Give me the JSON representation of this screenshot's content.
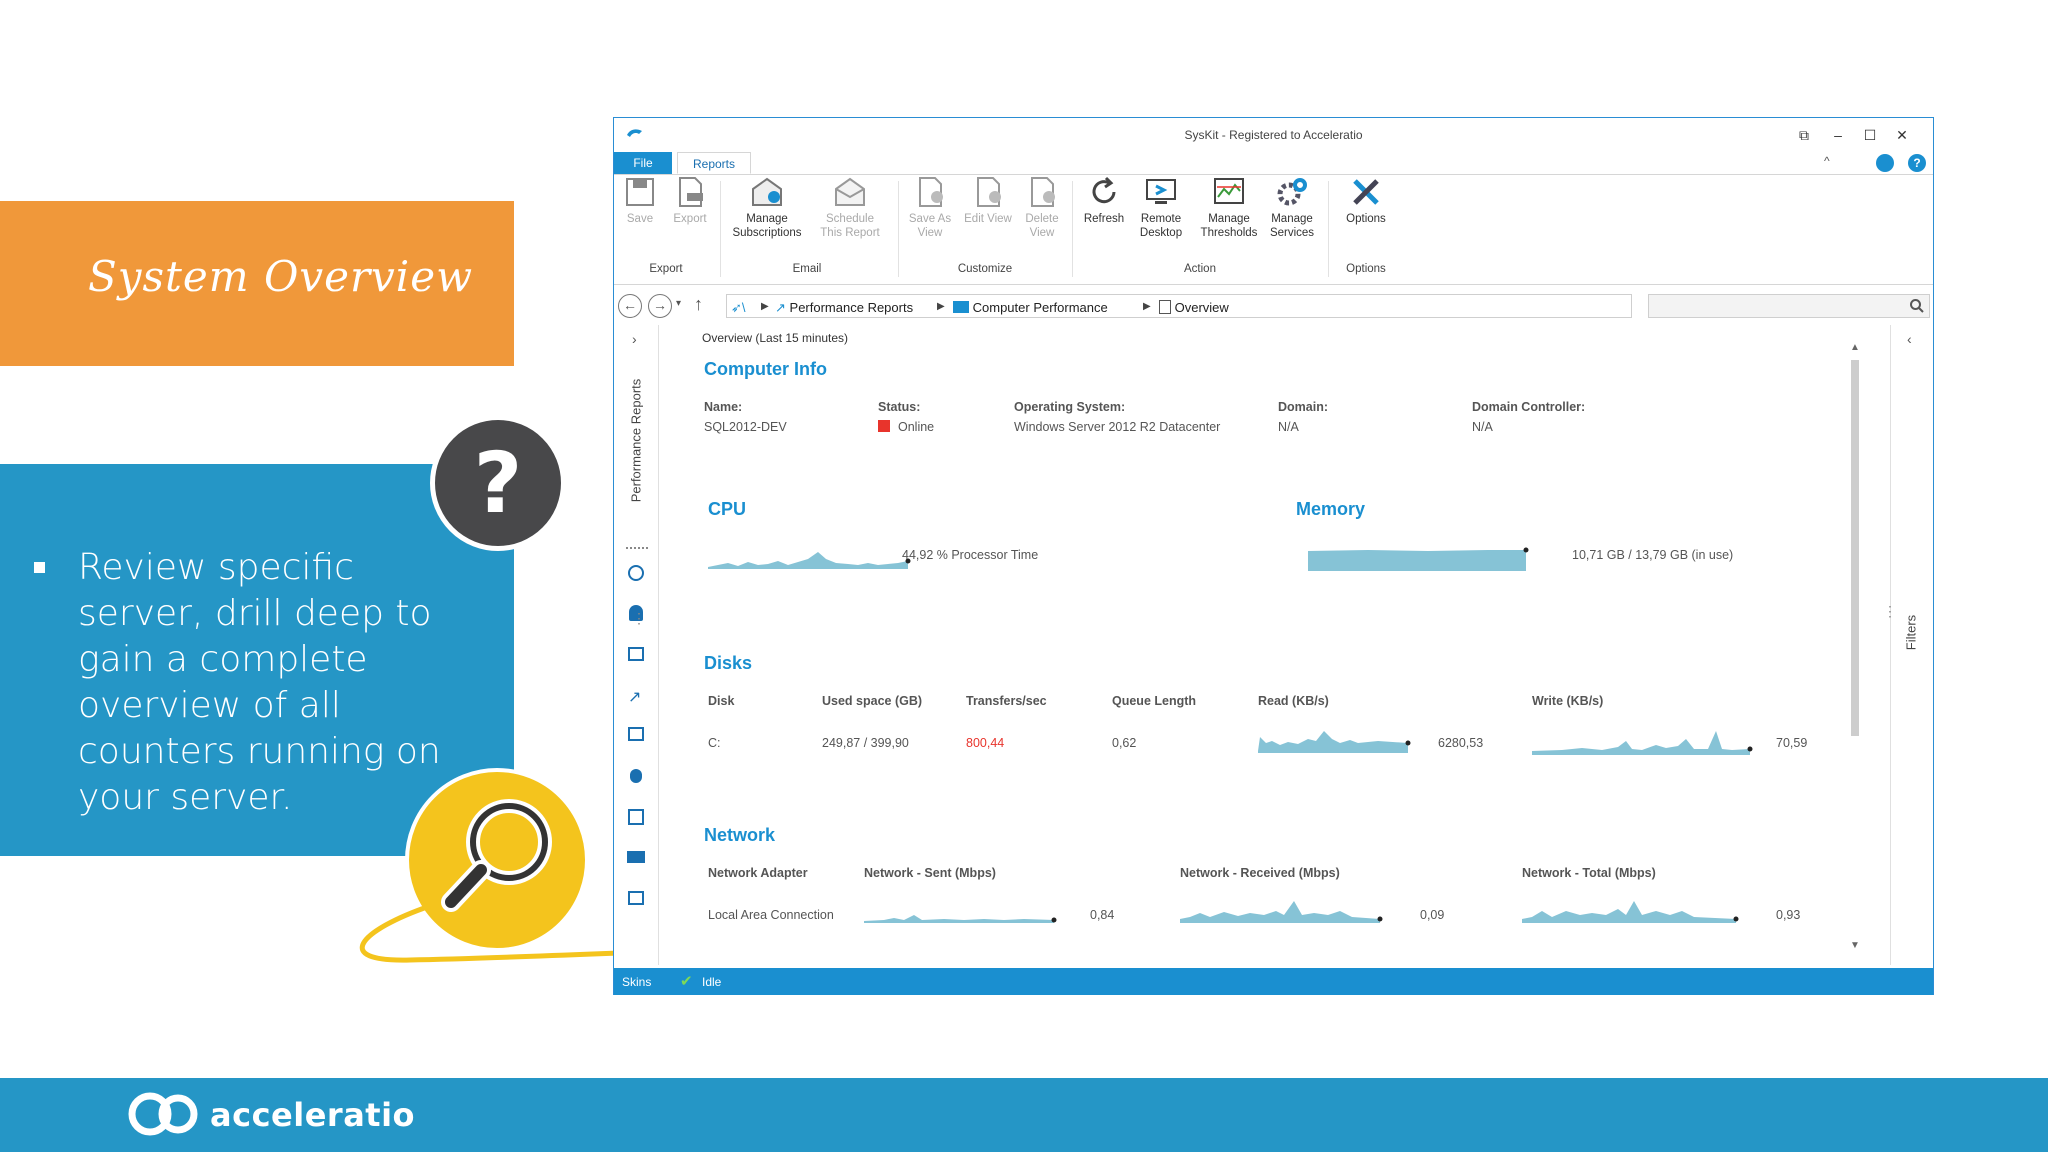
{
  "slide": {
    "title": "System Overview",
    "bullet": "Review specific server, drill deep to gain a complete overview of all counters running on your server.",
    "question_mark": "?",
    "brand": "acceleratio",
    "colors": {
      "orange": "#f0983a",
      "blue": "#2596c6",
      "yellow": "#f4c41d",
      "dark": "#48484a"
    }
  },
  "window": {
    "title": "SysKit - Registered to Acceleratio",
    "tabs": {
      "file": "File",
      "reports": "Reports"
    }
  },
  "ribbon": {
    "save": "Save",
    "export": "Export",
    "manage_subscriptions": "Manage Subscriptions",
    "schedule_report": "Schedule This Report",
    "save_as_view": "Save As View",
    "edit_view": "Edit View",
    "delete_view": "Delete View",
    "refresh": "Refresh",
    "remote_desktop": "Remote Desktop",
    "manage_thresholds": "Manage Thresholds",
    "manage_services": "Manage Services",
    "options": "Options",
    "groups": {
      "export": "Export",
      "email": "Email",
      "customize": "Customize",
      "action": "Action",
      "options": "Options"
    }
  },
  "breadcrumb": {
    "root": "\\",
    "item1": "Performance Reports",
    "item2": "Computer Performance",
    "item3": "Overview"
  },
  "left_rail": {
    "label": "Performance Reports"
  },
  "right_rail": {
    "label": "Filters"
  },
  "report": {
    "header": "Overview (Last 15 minutes)",
    "computer_info": {
      "title": "Computer Info",
      "name_label": "Name:",
      "name": "SQL2012-DEV",
      "status_label": "Status:",
      "status": "Online",
      "os_label": "Operating System:",
      "os": "Windows Server 2012 R2 Datacenter",
      "domain_label": "Domain:",
      "domain": "N/A",
      "dc_label": "Domain Controller:",
      "dc": "N/A"
    },
    "cpu": {
      "title": "CPU",
      "value": "44,92 % Processor Time"
    },
    "memory": {
      "title": "Memory",
      "value": "10,71 GB / 13,79 GB (in use)"
    },
    "disks": {
      "title": "Disks",
      "headers": [
        "Disk",
        "Used space (GB)",
        "Transfers/sec",
        "Queue Length",
        "Read (KB/s)",
        "Write (KB/s)"
      ],
      "row": {
        "disk": "C:",
        "used": "249,87 / 399,90",
        "transfers": "800,44",
        "queue": "0,62",
        "read": "6280,53",
        "write": "70,59"
      }
    },
    "network": {
      "title": "Network",
      "headers": [
        "Network Adapter",
        "Network - Sent (Mbps)",
        "Network - Received (Mbps)",
        "Network - Total (Mbps)"
      ],
      "row": {
        "adapter": "Local Area Connection",
        "sent": "0,84",
        "received": "0,09",
        "total": "0,93"
      }
    }
  },
  "statusbar": {
    "skins": "Skins",
    "state": "Idle"
  }
}
